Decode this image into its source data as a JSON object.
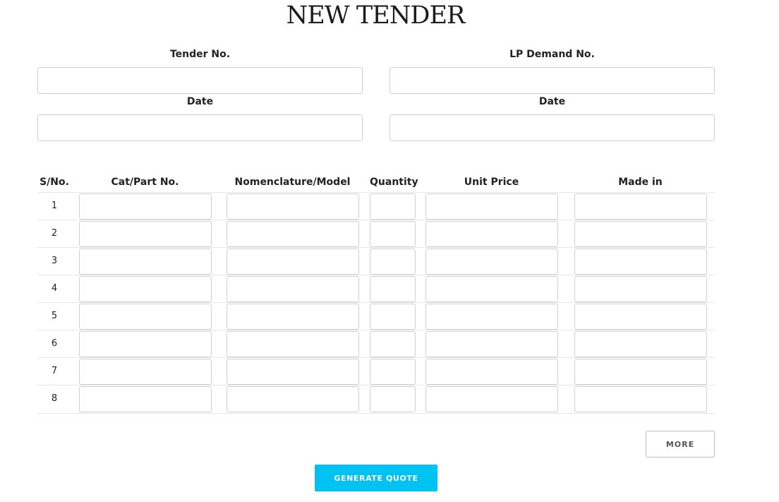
{
  "page": {
    "title": "NEW TENDER"
  },
  "form": {
    "tender_no_label": "Tender No.",
    "tender_no_value": "",
    "lp_demand_label": "LP Demand No.",
    "lp_demand_value": "",
    "date_left_label": "Date",
    "date_left_value": "",
    "date_right_label": "Date",
    "date_right_value": ""
  },
  "table": {
    "headers": [
      "S/No.",
      "Cat/Part No.",
      "Nomenclature/Model",
      "Quantity",
      "Unit Price",
      "Made in"
    ],
    "rows": [
      {
        "sno": "1"
      },
      {
        "sno": "2"
      },
      {
        "sno": "3"
      },
      {
        "sno": "4"
      },
      {
        "sno": "5"
      },
      {
        "sno": "6"
      },
      {
        "sno": "7"
      },
      {
        "sno": "8"
      }
    ]
  },
  "buttons": {
    "more_label": "MORE",
    "generate_label": "GENERATE QUOTE"
  },
  "colors": {
    "accent": "#00c2f2",
    "border": "#cfcfcf"
  }
}
